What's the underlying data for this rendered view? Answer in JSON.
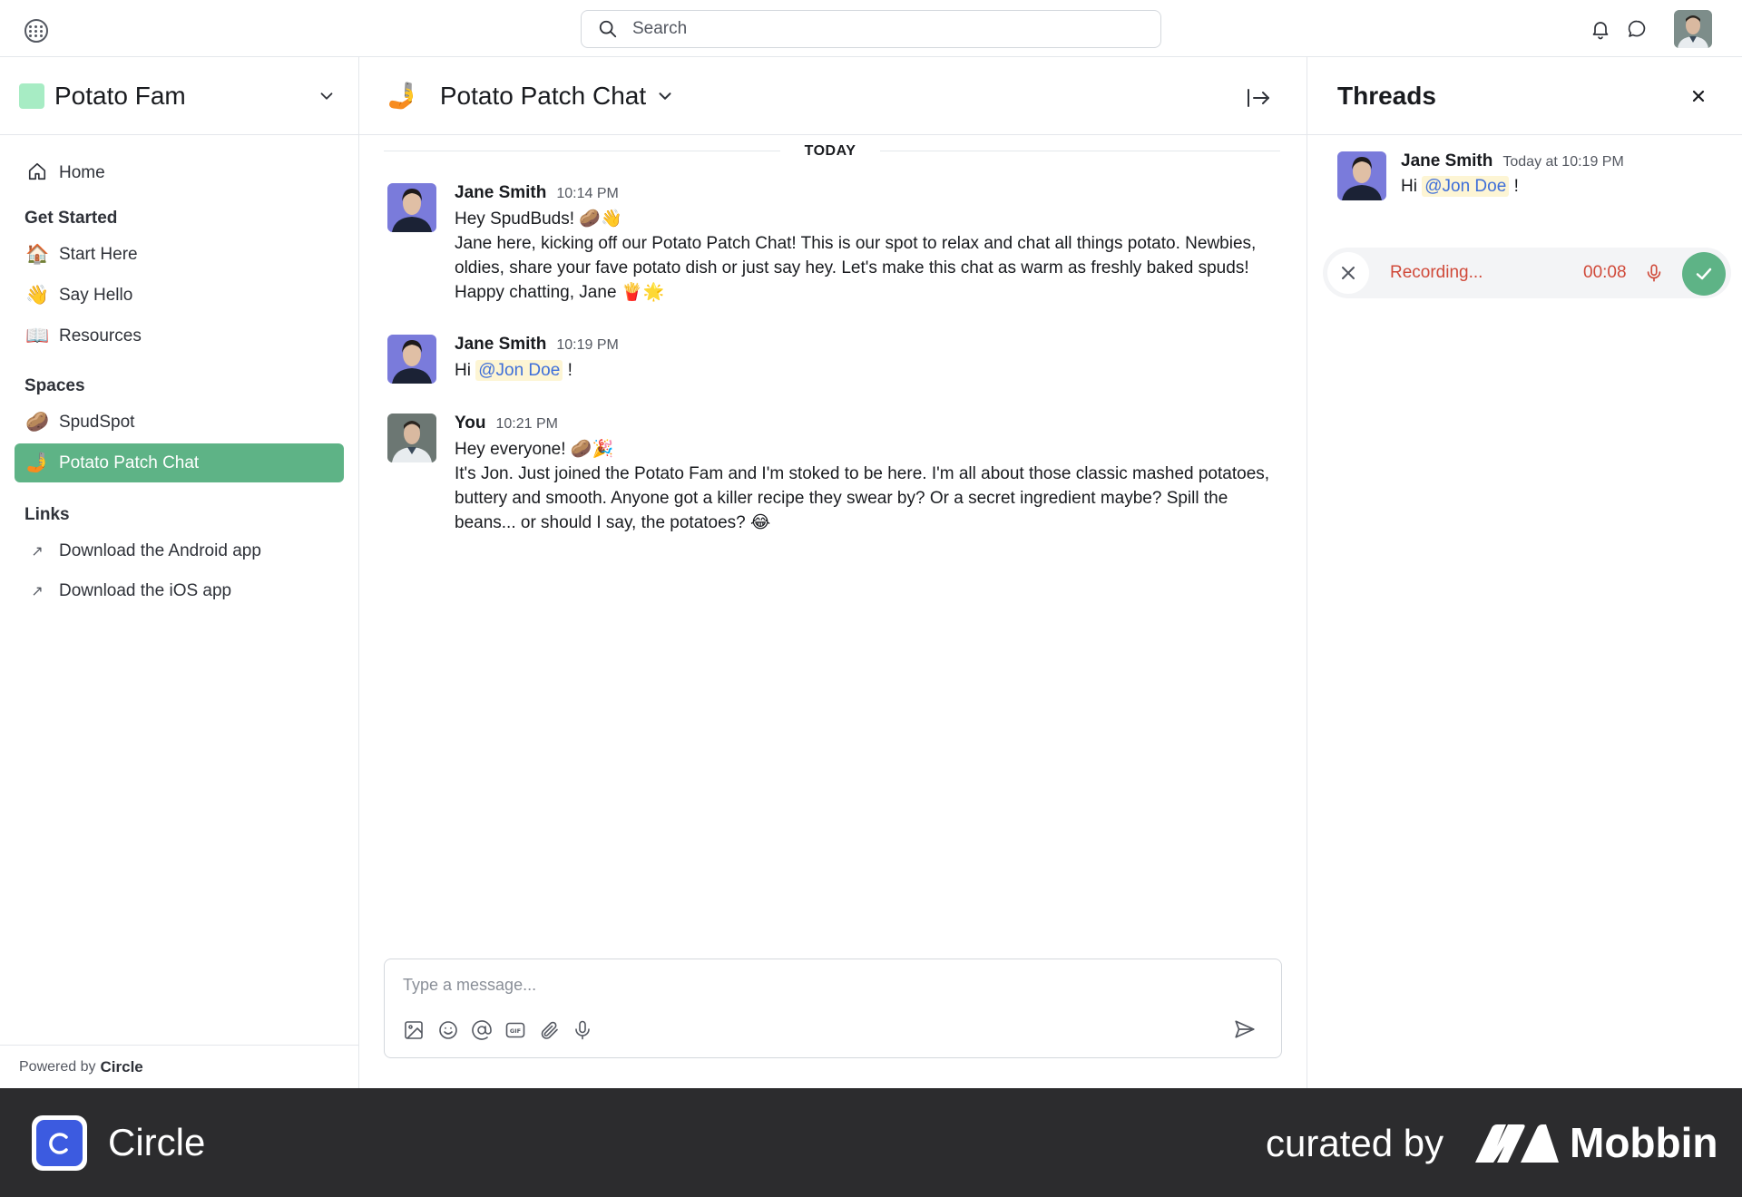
{
  "topbar": {
    "search_placeholder": "Search"
  },
  "sidebar": {
    "community_name": "Potato Fam",
    "home_label": "Home",
    "sections": {
      "get_started": {
        "title": "Get Started",
        "items": [
          {
            "emoji": "🏠",
            "label": "Start Here"
          },
          {
            "emoji": "👋",
            "label": "Say Hello"
          },
          {
            "emoji": "📖",
            "label": "Resources"
          }
        ]
      },
      "spaces": {
        "title": "Spaces",
        "items": [
          {
            "emoji": "🥔",
            "label": "SpudSpot"
          },
          {
            "emoji": "🤳",
            "label": "Potato Patch Chat"
          }
        ]
      },
      "links": {
        "title": "Links",
        "items": [
          {
            "icon": "↗",
            "label": "Download the Android app"
          },
          {
            "icon": "↗",
            "label": "Download the iOS app"
          }
        ]
      }
    },
    "powered_by": "Powered by",
    "powered_brand": "Circle"
  },
  "chat": {
    "emoji": "🤳",
    "title": "Potato Patch Chat",
    "divider": "TODAY",
    "messages": [
      {
        "author": "Jane Smith",
        "time": "10:14 PM",
        "line1": "Hey SpudBuds! 🥔👋",
        "line2": "Jane here, kicking off our Potato Patch Chat! This is our spot to relax and chat all things potato. Newbies, oldies, share your fave potato dish or just say hey. Let's make this chat as warm as freshly baked spuds! Happy chatting, Jane 🍟🌟"
      },
      {
        "author": "Jane Smith",
        "time": "10:19 PM",
        "prefix": "Hi ",
        "mention": "@Jon Doe",
        "suffix": " !"
      },
      {
        "author": "You",
        "time": "10:21 PM",
        "line1": "Hey everyone! 🥔🎉",
        "line2": "It's Jon. Just joined the Potato Fam and I'm stoked to be here. I'm all about those classic mashed potatoes, buttery and smooth. Anyone got a killer recipe they swear by? Or a secret ingredient maybe? Spill the beans... or should I say, the potatoes? 😂"
      }
    ],
    "composer_placeholder": "Type a message..."
  },
  "threads": {
    "title": "Threads",
    "message": {
      "author": "Jane Smith",
      "time": "Today at 10:19 PM",
      "prefix": "Hi ",
      "mention": "@Jon Doe",
      "suffix": " !"
    },
    "recording": {
      "label": "Recording...",
      "time": "00:08"
    }
  },
  "footer": {
    "brand": "Circle",
    "curated": "curated by",
    "mobbin": "Mobbin"
  },
  "colors": {
    "accent_green": "#5eb386",
    "recording_red": "#d04a3a",
    "mention_blue": "#3f6fd9",
    "footer_bg": "#2c2c2e"
  }
}
